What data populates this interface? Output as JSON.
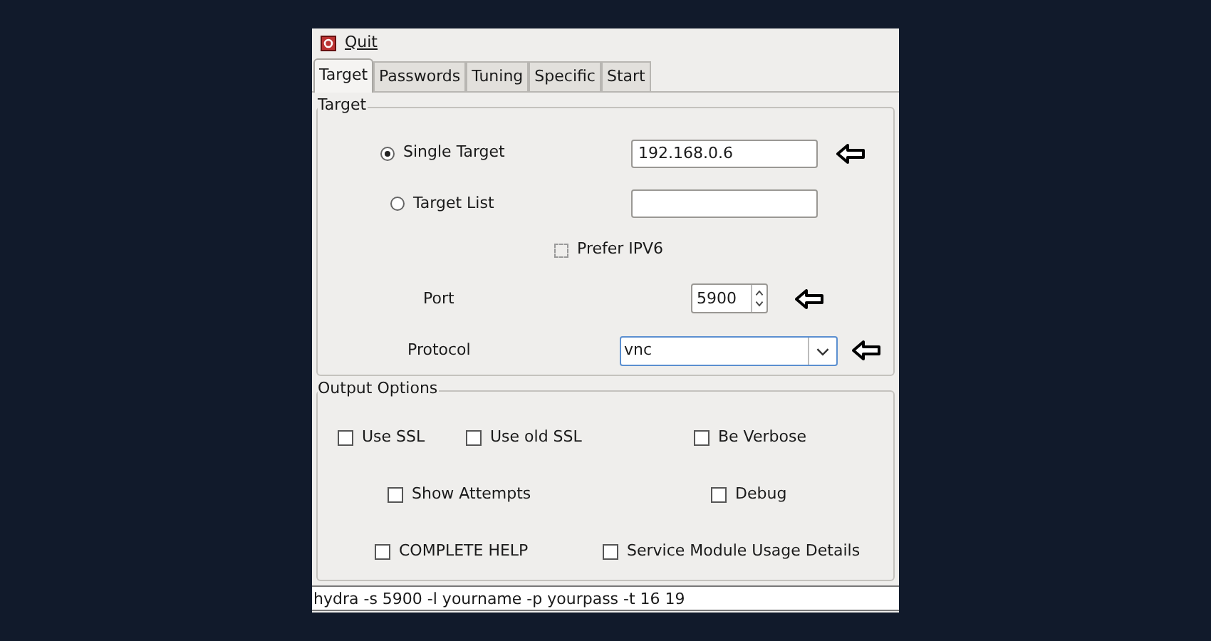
{
  "menu": {
    "label": "Quit"
  },
  "tabs": [
    {
      "label": "Target",
      "selected": true
    },
    {
      "label": "Passwords",
      "selected": false
    },
    {
      "label": "Tuning",
      "selected": false
    },
    {
      "label": "Specific",
      "selected": false
    },
    {
      "label": "Start",
      "selected": false
    }
  ],
  "target": {
    "title": "Target",
    "modes": [
      {
        "label": "Single Target",
        "selected": true,
        "value": "192.168.0.6",
        "annotated": true
      },
      {
        "label": "Target List",
        "selected": false,
        "annotated": false
      }
    ],
    "prefer_ipv6": {
      "label": "Prefer IPV6",
      "checked": false
    },
    "port": {
      "label": "Port",
      "value": "5900",
      "annotated": true
    },
    "protocol": {
      "label": "Protocol",
      "value": "vnc",
      "annotated": true
    }
  },
  "output_options": {
    "title": "Output Options",
    "rows": [
      [
        {
          "label": "Use SSL",
          "checked": false
        },
        {
          "label": "Use old SSL",
          "checked": false
        },
        {
          "label": "Be Verbose",
          "checked": false
        }
      ],
      [
        {
          "label": "Show Attempts",
          "checked": false
        },
        {
          "label": "Debug",
          "checked": false
        }
      ],
      [
        {
          "label": "COMPLETE HELP",
          "checked": false
        },
        {
          "label": "Service Module Usage Details",
          "checked": false
        }
      ]
    ]
  },
  "command": "hydra -s 5900 -l yourname -p yourpass -t 16 19"
}
